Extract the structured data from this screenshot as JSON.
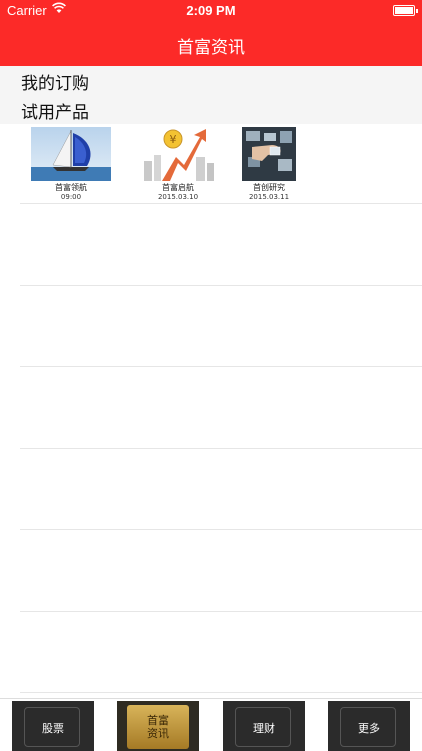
{
  "status_bar": {
    "carrier": "Carrier",
    "time": "2:09 PM"
  },
  "nav": {
    "title": "首富资讯"
  },
  "sections": {
    "my_subscriptions": "我的订购",
    "trial_products": "试用产品"
  },
  "products": [
    {
      "name": "首富领航",
      "date": "09:00",
      "icon": "sailboat-image"
    },
    {
      "name": "首富启航",
      "date": "2015.03.10",
      "icon": "rising-arrow-coin-image"
    },
    {
      "name": "首创研究",
      "date": "2015.03.11",
      "icon": "touchscreen-hand-image"
    }
  ],
  "tabs": [
    {
      "label": "股票",
      "active": false
    },
    {
      "label": "首富\n资讯",
      "active": true
    },
    {
      "label": "理财",
      "active": false
    },
    {
      "label": "更多",
      "active": false
    }
  ],
  "colors": {
    "brand_red": "#fc2a28",
    "tab_dark": "#2b2b2b",
    "tab_gold": "#c89f45"
  }
}
